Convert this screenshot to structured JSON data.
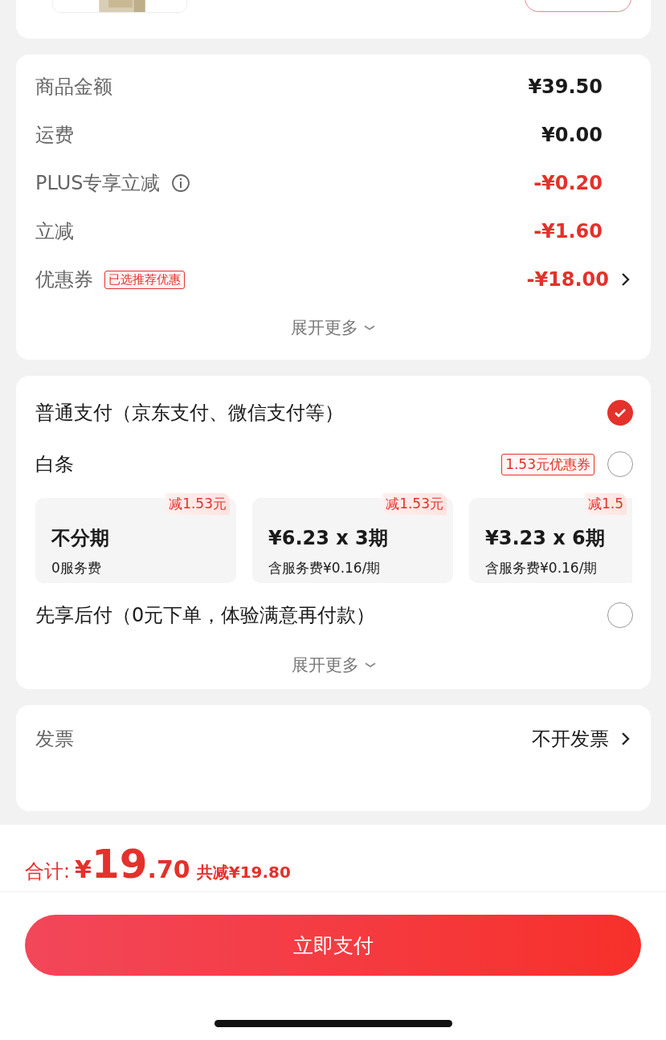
{
  "price_summary": {
    "rows": [
      {
        "label": "商品金额",
        "value": "¥39.50",
        "kind": "amount",
        "info": false,
        "chevron": false
      },
      {
        "label": "运费",
        "value": "¥0.00",
        "kind": "amount",
        "info": false,
        "chevron": false
      },
      {
        "label": "PLUS专享立减",
        "value": "-¥0.20",
        "kind": "discount",
        "info": true,
        "chevron": false
      },
      {
        "label": "立减",
        "value": "-¥1.60",
        "kind": "discount",
        "info": false,
        "chevron": false
      },
      {
        "label": "优惠券",
        "badge": "已选推荐优惠",
        "value": "-¥18.00",
        "kind": "discount",
        "info": false,
        "chevron": true
      }
    ],
    "expand": "展开更多"
  },
  "payment": {
    "methods": [
      {
        "label": "普通支付（京东支付、微信支付等）",
        "selected": true
      },
      {
        "label": "白条",
        "badge": "1.53元优惠券",
        "selected": false,
        "installments": [
          {
            "tag": "减1.53元",
            "title": "不分期",
            "sub": "0服务费",
            "clipped": false
          },
          {
            "tag": "减1.53元",
            "title": "¥6.23 x 3期",
            "sub": "含服务费¥0.16/期",
            "clipped": false
          },
          {
            "tag": "减1.5",
            "title": "¥3.23 x 6期",
            "sub": "含服务费¥0.16/期",
            "clipped": true
          }
        ]
      },
      {
        "label": "先享后付（0元下单，体验满意再付款）",
        "selected": false
      }
    ],
    "expand": "展开更多"
  },
  "invoice": {
    "label": "发票",
    "value": "不开发票"
  },
  "footer": {
    "total_label": "合计:",
    "currency": "¥",
    "integer": "19",
    "decimal": ".70",
    "saved": "共减¥19.80",
    "pay_button": "立即支付"
  }
}
